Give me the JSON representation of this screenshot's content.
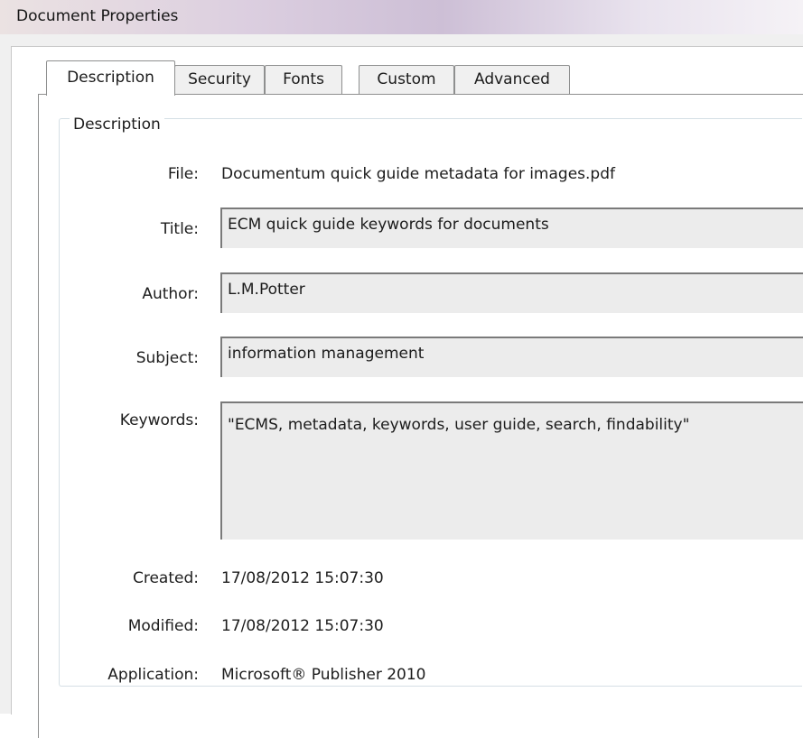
{
  "window": {
    "title": "Document Properties"
  },
  "tabs": [
    {
      "label": "Description",
      "active": true
    },
    {
      "label": "Security",
      "active": false
    },
    {
      "label": "Fonts",
      "active": false
    },
    {
      "label": "Custom",
      "active": false
    },
    {
      "label": "Advanced",
      "active": false
    }
  ],
  "description": {
    "group_title": "Description",
    "file": {
      "label": "File:",
      "value": "Documentum quick guide metadata for images.pdf"
    },
    "title": {
      "label": "Title:",
      "value": "ECM quick guide keywords for documents"
    },
    "author": {
      "label": "Author:",
      "value": "L.M.Potter"
    },
    "subject": {
      "label": "Subject:",
      "value": "information management"
    },
    "keywords": {
      "label": "Keywords:",
      "value": "\"ECMS, metadata, keywords, user guide, search, findability\""
    },
    "created": {
      "label": "Created:",
      "value": "17/08/2012 15:07:30"
    },
    "modified": {
      "label": "Modified:",
      "value": "17/08/2012 15:07:30"
    },
    "application": {
      "label": "Application:",
      "value": "Microsoft® Publisher 2010"
    }
  },
  "colors": {
    "field_background": "#ececec",
    "field_border": "#7a7a7a",
    "tab_border": "#8e8f8f"
  }
}
